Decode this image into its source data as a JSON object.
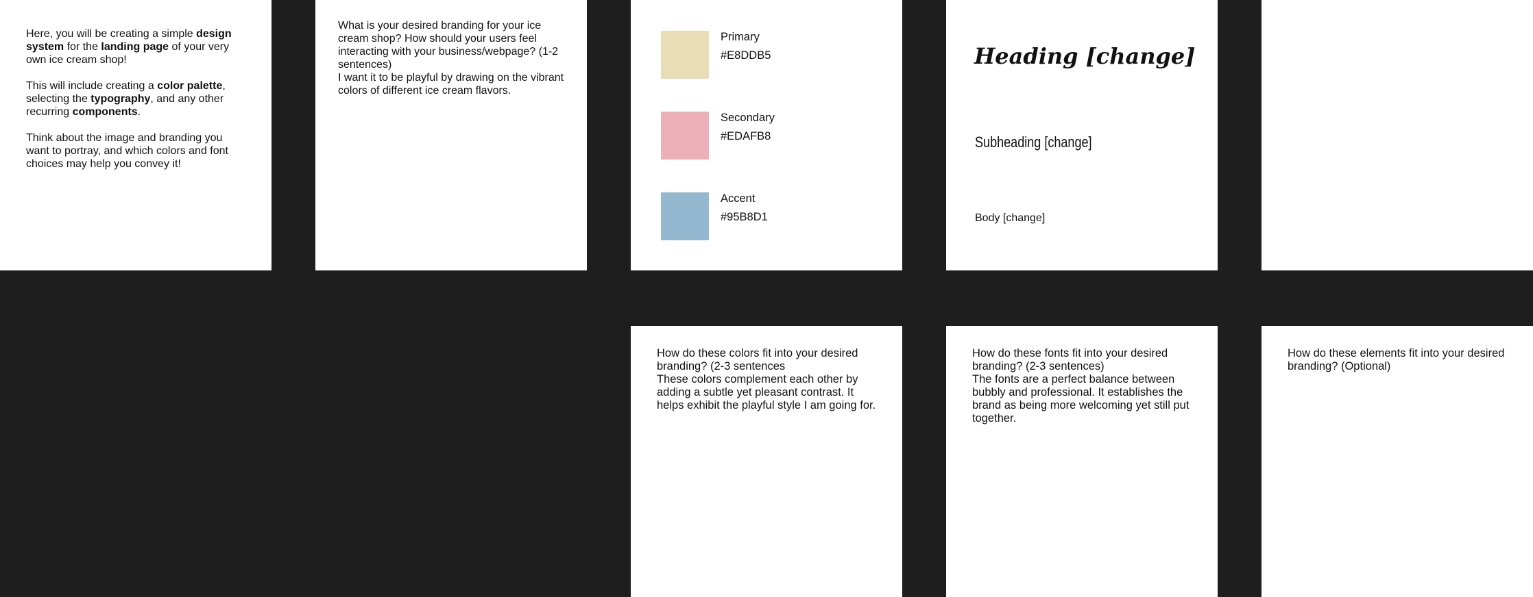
{
  "intro": {
    "p1_a": "Here, you will be creating a simple ",
    "p1_b": "design system",
    "p1_c": " for the ",
    "p1_d": "landing page",
    "p1_e": " of your very own ice cream shop!",
    "p2_a": "This will include creating a ",
    "p2_b": "color palette",
    "p2_c": ", selecting the ",
    "p2_d": "typography",
    "p2_e": ", and any other recurring ",
    "p2_f": "components",
    "p2_g": ".",
    "p3": "Think about the image and branding you want to portray, and which colors and font choices may help you convey it!"
  },
  "branding": {
    "question": "What is your desired branding for your ice cream shop? How should your users feel interacting with your business/webpage? (1-2 sentences)",
    "answer": "I want it to be playful by drawing on the vibrant colors of different ice cream flavors."
  },
  "palette": {
    "primary": {
      "label": "Primary",
      "hex": "#E8DDB5",
      "color": "#E8DDB5"
    },
    "secondary": {
      "label": "Secondary",
      "hex": "#EDAFB8",
      "color": "#EDAFB8"
    },
    "accent": {
      "label": "Accent",
      "hex": "#95B8D1",
      "color": "#95B8D1"
    }
  },
  "typography": {
    "heading": "Heading [change]",
    "subheading": "Subheading [change]",
    "body": "Body [change]"
  },
  "colors_fit": {
    "question": "How do these colors fit into your desired branding? (2-3 sentences",
    "answer": "These colors complement each other by adding a subtle yet pleasant contrast. It helps exhibit the playful style I am going for."
  },
  "fonts_fit": {
    "question": "How do these fonts fit into your desired branding? (2-3 sentences)",
    "answer": "The fonts are a perfect balance between bubbly and professional. It establishes the brand as being more welcoming yet still put together."
  },
  "elements_fit": {
    "question": "How do these elements fit into your desired branding? (Optional)"
  }
}
